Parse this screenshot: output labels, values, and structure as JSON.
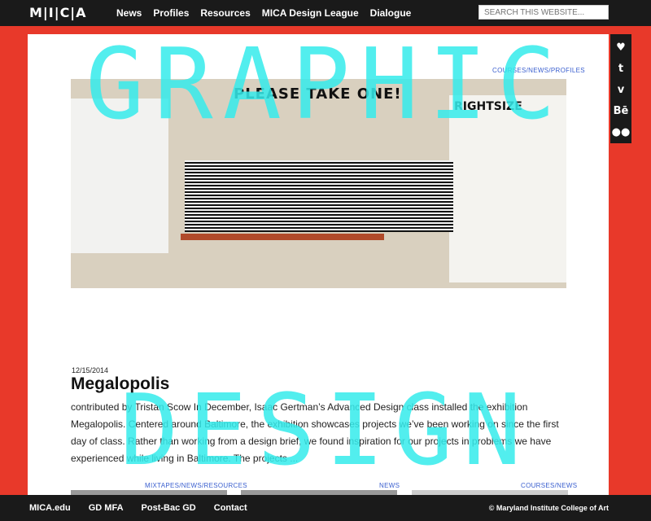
{
  "header": {
    "logo": "M|I|C|A",
    "nav": [
      "News",
      "Profiles",
      "Resources",
      "MICA Design League",
      "Dialogue"
    ],
    "search_placeholder": "SEARCH THIS WEBSITE..."
  },
  "social": [
    "twitter-icon",
    "tumblr-icon",
    "vimeo-icon",
    "behance-icon",
    "flickr-icon"
  ],
  "social_glyphs": [
    "♥",
    "t",
    "v",
    "Bē",
    "●●"
  ],
  "overlay": {
    "line1": "GRAPHIC",
    "line2": "DESIGN"
  },
  "post": {
    "crumb": "COURSES/NEWS/PROFILES",
    "hero_sign": "PLEASE TAKE ONE!",
    "hero_right_title": "RIGHTSIZE",
    "date": "12/15/2014",
    "title": "Megalopolis",
    "excerpt": "contributed by Tristan Scow In December, Isaac Gertman’s Advanced Design class installed the exhibition Megalopolis. Centered around Baltimore, the exhibition showcases projects we’ve been working on since the first day of class. Rather than working from a design brief, we found inspiration for our projects in problems we have experienced while living in Baltimore. The projects ..."
  },
  "next_crumbs": [
    "MIXTAPES/NEWS/RESOURCES",
    "NEWS",
    "COURSES/NEWS"
  ],
  "footer": {
    "links": [
      "MICA.edu",
      "GD MFA",
      "Post-Bac GD",
      "Contact"
    ],
    "copyright": "© Maryland Institute College of Art"
  },
  "colors": {
    "background": "#e8392a",
    "bar": "#1a1a1a",
    "overlay": "#35ecec",
    "link": "#3a5fcf"
  }
}
